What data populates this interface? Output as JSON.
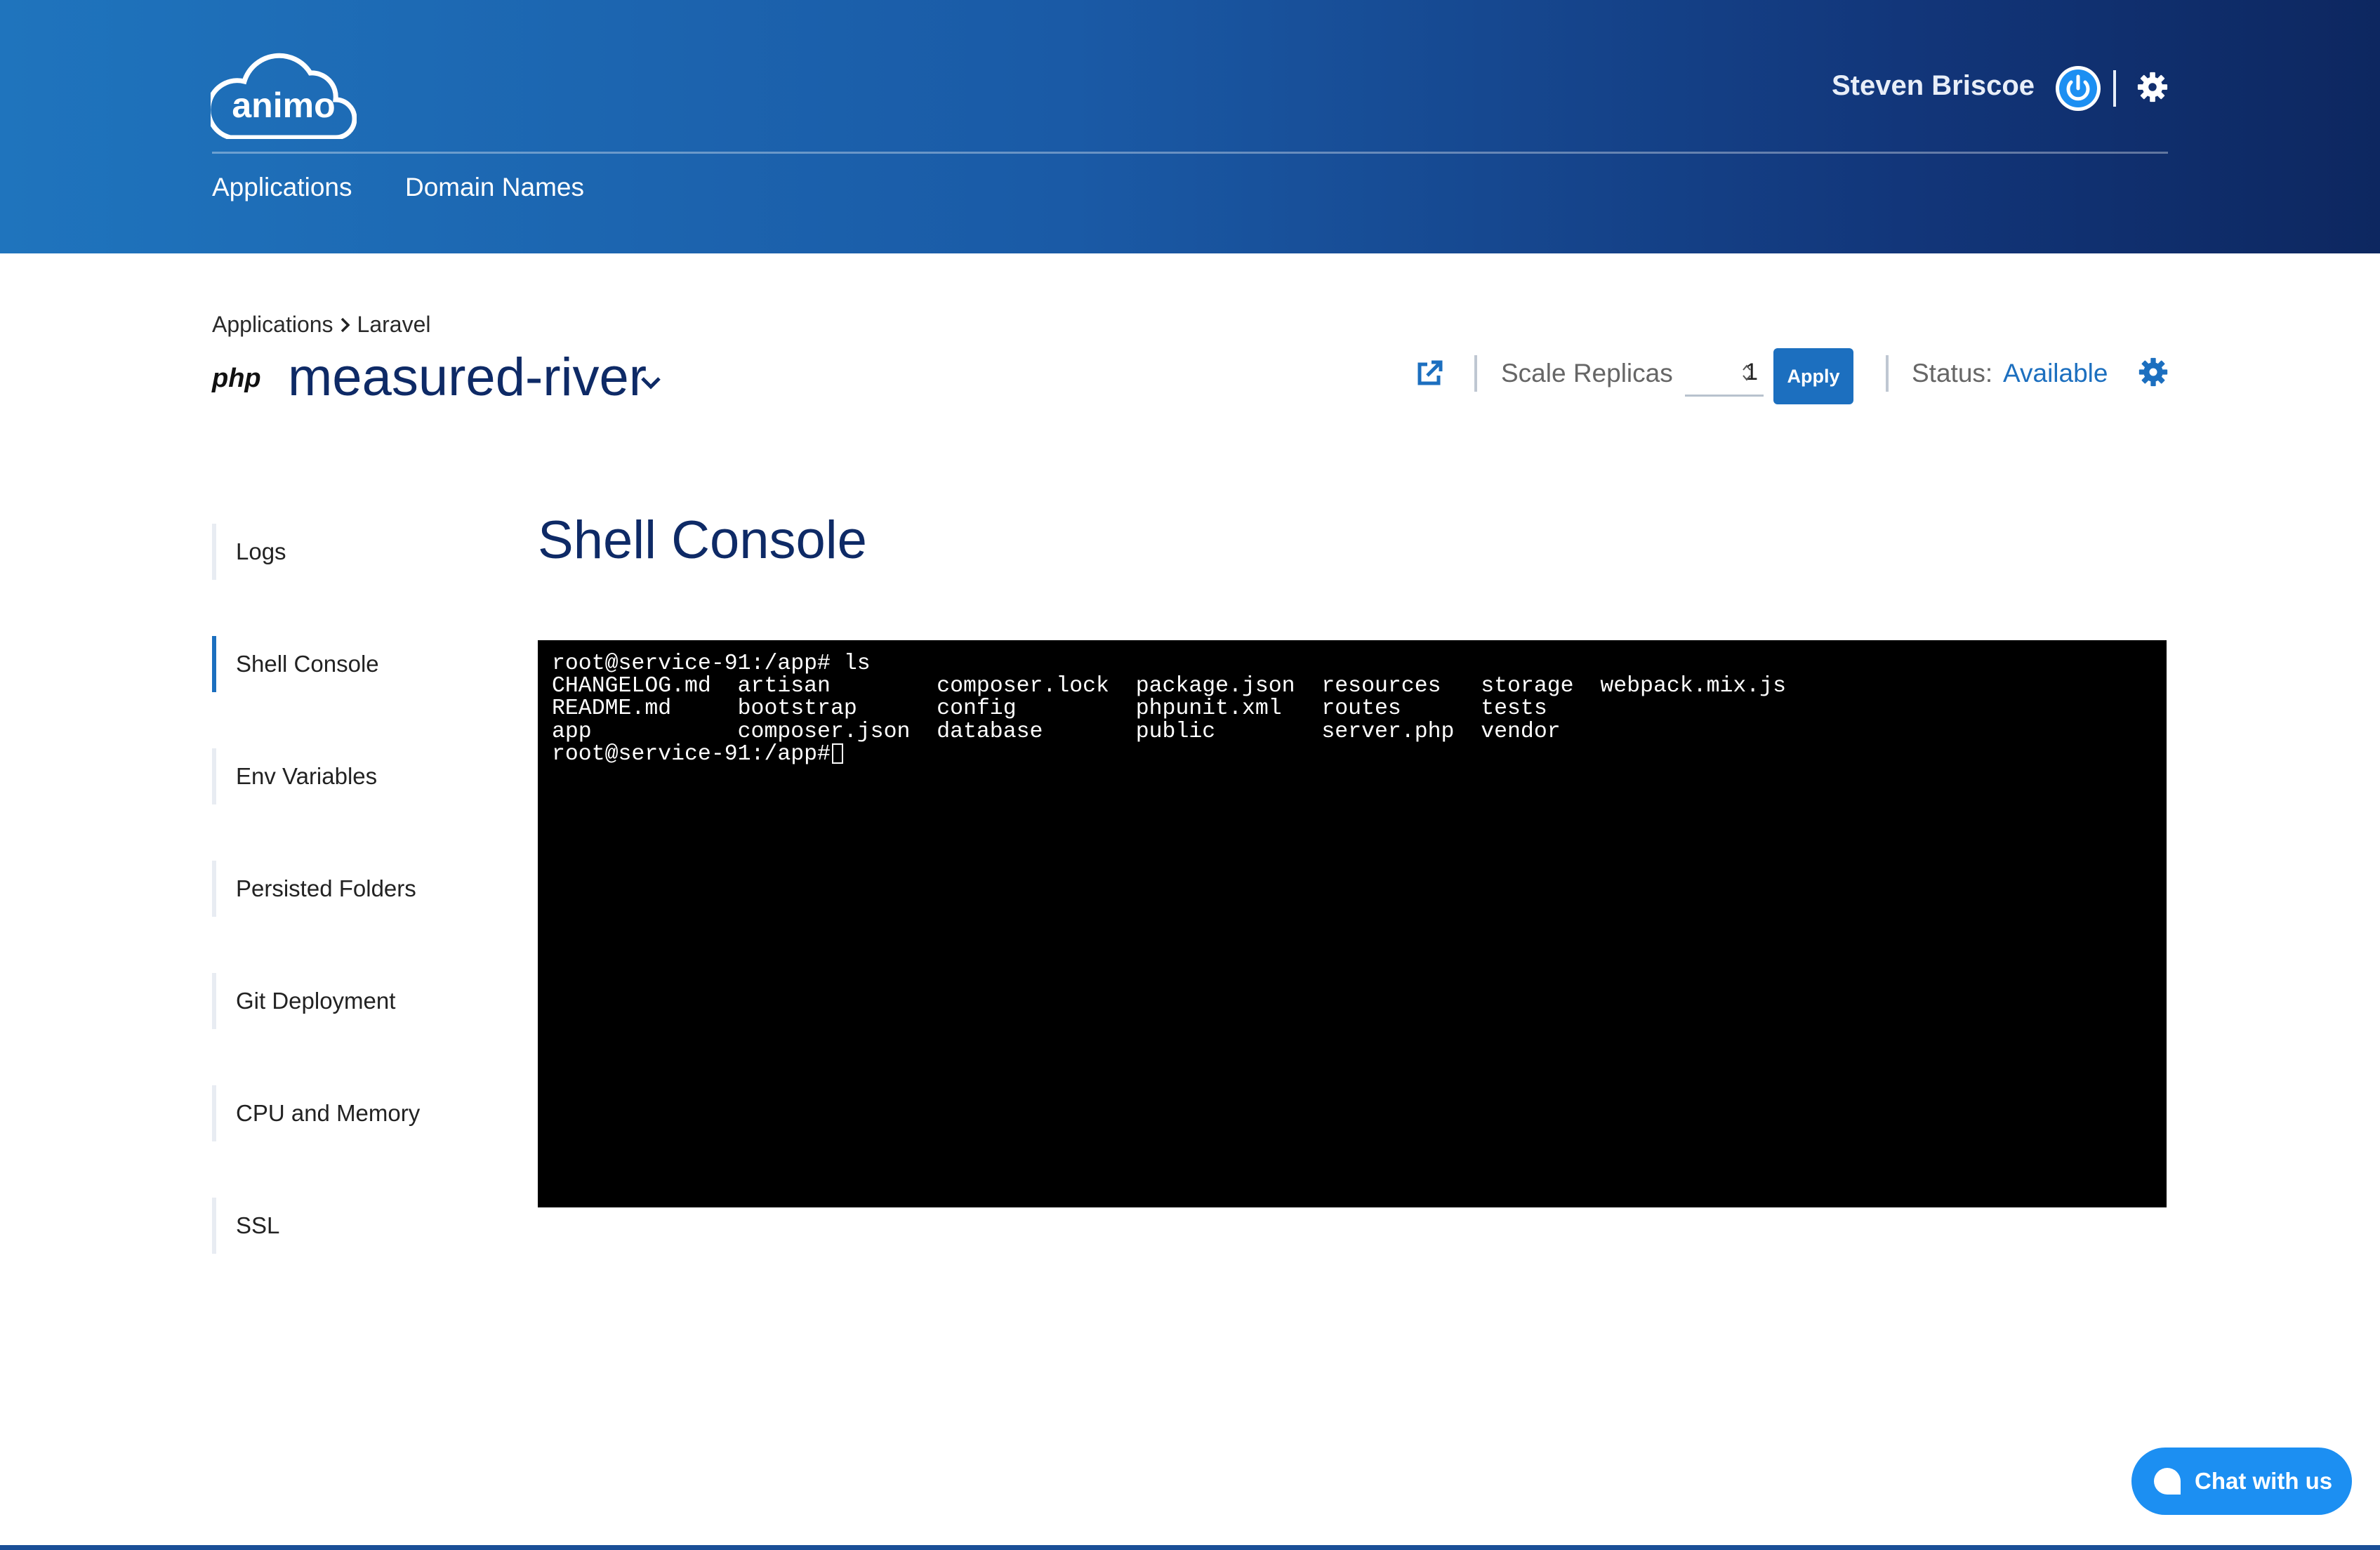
{
  "header": {
    "logo_text": "animo",
    "user_name": "Steven Briscoe",
    "nav": [
      {
        "label": "Applications"
      },
      {
        "label": "Domain Names"
      }
    ]
  },
  "breadcrumb": {
    "items": [
      "Applications",
      "Laravel"
    ]
  },
  "app": {
    "runtime_logo": "php",
    "name": "measured-river",
    "scale_label": "Scale Replicas",
    "replicas": "1",
    "apply_label": "Apply",
    "status_label": "Status:",
    "status_value": "Available"
  },
  "sidebar": {
    "items": [
      {
        "label": "Logs"
      },
      {
        "label": "Shell Console",
        "active": true
      },
      {
        "label": "Env Variables"
      },
      {
        "label": "Persisted Folders"
      },
      {
        "label": "Git Deployment"
      },
      {
        "label": "CPU and Memory"
      },
      {
        "label": "SSL"
      }
    ]
  },
  "main": {
    "title": "Shell Console",
    "terminal_output": "root@service-91:/app# ls\nCHANGELOG.md  artisan        composer.lock  package.json  resources   storage  webpack.mix.js\nREADME.md     bootstrap      config         phpunit.xml   routes      tests\napp           composer.json  database       public        server.php  vendor\nroot@service-91:/app# "
  },
  "chat": {
    "label": "Chat with us"
  },
  "colors": {
    "accent": "#1c6fbf",
    "title_navy": "#0e2a66",
    "header_start": "#1f74bd",
    "header_end": "#0d2760",
    "chat_blue": "#1c8ff2"
  },
  "icons": [
    "cloud-logo-icon",
    "power-icon",
    "gear-icon",
    "chevron-right-icon",
    "chevron-down-icon",
    "external-link-icon",
    "spinner-icon",
    "chat-bubble-icon"
  ]
}
